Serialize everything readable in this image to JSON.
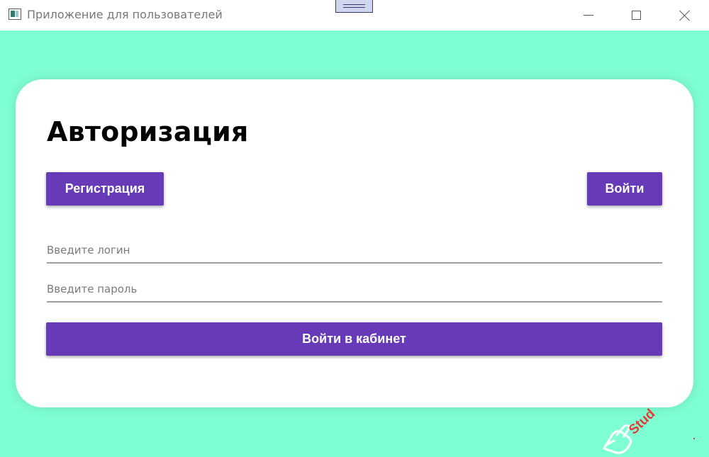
{
  "window": {
    "title": "Приложение для пользователей"
  },
  "card": {
    "heading": "Авторизация",
    "register_label": "Регистрация",
    "login_label": "Войти",
    "login_placeholder": "Введите логин",
    "login_value": "",
    "password_placeholder": "Введите пароль",
    "password_value": "",
    "submit_label": "Войти в кабинет"
  },
  "watermark": {
    "text": "Stud"
  },
  "colors": {
    "background": "#7fffd4",
    "accent": "#673ab7",
    "card": "#ffffff",
    "watermark": "#e53935"
  },
  "icons": {
    "app": "app-window-icon",
    "minimize": "minimize-icon",
    "maximize": "maximize-icon",
    "close": "close-icon"
  }
}
